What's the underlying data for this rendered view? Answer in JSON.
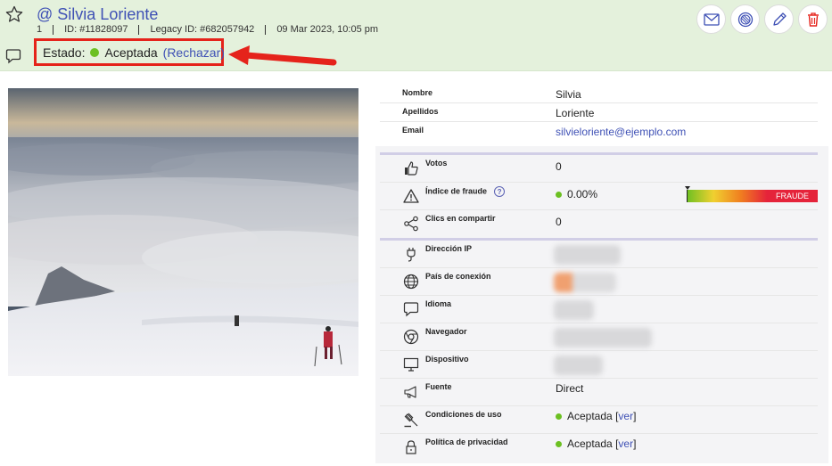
{
  "user": {
    "handle_symbol": "@",
    "name": "Silvia Loriente",
    "index": "1",
    "id": "ID: #11828097",
    "legacy_id": "Legacy ID: #682057942",
    "datetime": "09 Mar 2023, 10:05 pm"
  },
  "status": {
    "label": "Estado:",
    "value": "Aceptada",
    "action": "(Rechazar)",
    "dot_color": "#6cc022"
  },
  "actions": [
    "mail-icon",
    "block-icon",
    "edit-icon",
    "delete-icon"
  ],
  "profile": [
    {
      "label": "Nombre",
      "value": "Silvia"
    },
    {
      "label": "Apellidos",
      "value": "Loriente"
    },
    {
      "label": "Email",
      "value": "silvieloriente@ejemplo.com"
    }
  ],
  "stats": {
    "votos": {
      "label": "Votos",
      "value": "0",
      "icon": "thumbs-up-icon"
    },
    "fraude": {
      "label": "Índice de fraude",
      "help": "?",
      "value": "0.00%",
      "bar_label": "FRAUDE",
      "level": 0.0,
      "icon": "warning-icon"
    },
    "clics": {
      "label": "Clics en compartir",
      "value": "0",
      "icon": "share-icon"
    }
  },
  "technical": {
    "ip": {
      "label": "Dirección IP",
      "icon": "plug-icon"
    },
    "pais": {
      "label": "País de conexión",
      "icon": "globe-icon"
    },
    "idioma": {
      "label": "Idioma",
      "icon": "speech-bubble-icon"
    },
    "navegador": {
      "label": "Navegador",
      "icon": "chrome-icon"
    },
    "dispositivo": {
      "label": "Dispositivo",
      "icon": "monitor-icon"
    },
    "fuente": {
      "label": "Fuente",
      "value": "Direct",
      "icon": "megaphone-icon"
    },
    "condiciones": {
      "label": "Condiciones de uso",
      "value": "Aceptada",
      "bracket_open": "[",
      "link": "ver",
      "bracket_close": "]",
      "icon": "gavel-icon"
    },
    "privacidad": {
      "label": "Política de privacidad",
      "value": "Aceptada",
      "bracket_open": "[",
      "link": "ver",
      "bracket_close": "]",
      "icon": "lock-icon"
    }
  },
  "colors": {
    "accent": "#3f51b5",
    "header_bg": "#e4f1dc",
    "highlight": "#e5231b",
    "accepted": "#6cc022",
    "fraud_red": "#e5233a"
  }
}
